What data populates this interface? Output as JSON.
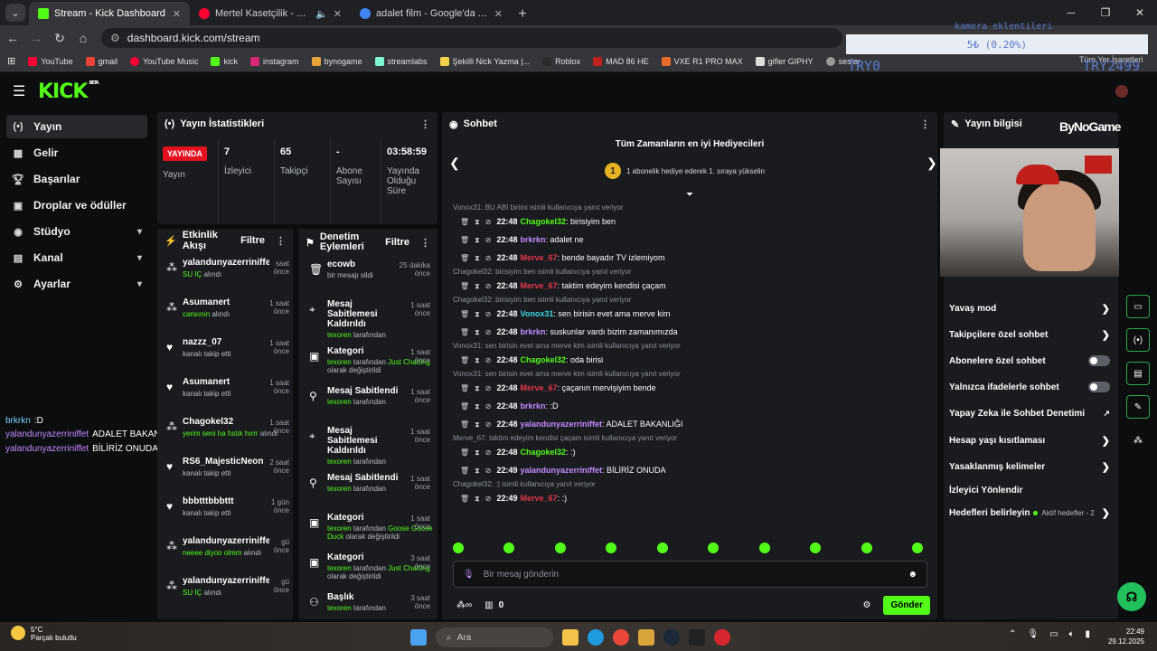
{
  "browser": {
    "tabs": [
      {
        "title": "Stream - Kick Dashboard",
        "color": "#53fc18"
      },
      {
        "title": "Mertel Kasetçilik - YouTube",
        "color": "#ff0033"
      },
      {
        "title": "adalet film - Google'da Ara",
        "color": "#4285f4"
      }
    ],
    "url": "dashboard.kick.com/stream",
    "bookmarks": [
      "YouTube",
      "gmail",
      "YouTube Music",
      "kick",
      "instagram",
      "bynogame",
      "streamlabs",
      "Şekilli Nick Yazma |...",
      "Roblox",
      "MAD 86 HE",
      "VXE R1 PRO MAX",
      "gifler GIPHY",
      "sesler"
    ],
    "bookmarks_right": "Tüm Yer İşaretleri"
  },
  "stream_overlay": {
    "cam_label": "kamera eklentileri",
    "goal_text": "5₺ (0.20%)",
    "try_left": "TRY0",
    "try_right": "TRY2499",
    "chat_lines": [
      {
        "user": "brkrkn",
        "text": ":D"
      },
      {
        "user": "yalandunyazerriniffet",
        "text": "ADALET BAKANLIĞI"
      },
      {
        "user": "yalandunyazerriniffet",
        "text": "BİLİRİZ ONUDA"
      }
    ]
  },
  "kick": {
    "logo": "KICK",
    "logo_sup": "BETA",
    "accent": "#53fc18"
  },
  "sidebar": {
    "items": [
      {
        "label": "Yayın",
        "icon": "broadcast-icon"
      },
      {
        "label": "Gelir",
        "icon": "wallet-icon"
      },
      {
        "label": "Başarılar",
        "icon": "trophy-icon"
      },
      {
        "label": "Droplar ve ödüller",
        "icon": "gift-icon"
      },
      {
        "label": "Stüdyo",
        "icon": "studio-icon"
      },
      {
        "label": "Kanal",
        "icon": "channel-icon"
      },
      {
        "label": "Ayarlar",
        "icon": "gear-icon"
      }
    ]
  },
  "stats": {
    "title": "Yayın İstatistikleri",
    "live_badge": "YAYINDA",
    "stream_label": "Yayın",
    "viewers": "7",
    "viewers_label": "İzleyici",
    "followers": "65",
    "followers_label": "Takipçi",
    "subs": "-",
    "subs_label": "Abone Sayısı",
    "duration": "03:58:59",
    "duration_label": "Yayında Olduğu Süre"
  },
  "feed": {
    "title": "Etkinlik Akışı",
    "filter": "Filtre",
    "items": [
      {
        "name": "yalandunyazerriniffet",
        "time": "saat önce",
        "pre": "SU İÇ",
        "post": " alındı",
        "icon": "drop"
      },
      {
        "name": "Asumanert",
        "time": "1 saat önce",
        "pre": "cansının",
        "post": " alındı",
        "icon": "drop"
      },
      {
        "name": "nazzz_07",
        "time": "1 saat önce",
        "pre": "",
        "post": "kanalı takip etti",
        "icon": "heart"
      },
      {
        "name": "Asumanert",
        "time": "1 saat önce",
        "pre": "",
        "post": "kanalı takip etti",
        "icon": "heart"
      },
      {
        "name": "Chagokel32",
        "time": "1 saat önce",
        "pre": "yerim seni ha fıstık hırrr",
        "post": " alındı",
        "icon": "drop"
      },
      {
        "name": "RS6_MajesticNeon",
        "time": "2 saat önce",
        "pre": "",
        "post": "kanalı takip etti",
        "icon": "heart"
      },
      {
        "name": "bbbtttbbbttt",
        "time": "1 gün önce",
        "pre": "",
        "post": "kanalı takip etti",
        "icon": "heart"
      },
      {
        "name": "yalandunyazerriniffet",
        "time": "gü önce",
        "pre": "neeee diyoo olmm",
        "post": " alındı",
        "icon": "drop"
      },
      {
        "name": "yalandunyazerriniffet",
        "time": "gü önce",
        "pre": "SU İÇ",
        "post": " alındı",
        "icon": "drop"
      }
    ]
  },
  "mod": {
    "title": "Denetim Eylemleri",
    "filter": "Filtre",
    "items": [
      {
        "title": "ecowb",
        "time": "25 dakika önce",
        "sub_user": "",
        "sub_text": "bir mesajı sildi",
        "icon": "trash"
      },
      {
        "title": "Mesaj Sabitlemesi Kaldırıldı",
        "time": "1 saat önce",
        "sub_user": "texoren",
        "sub_text": " tarafından",
        "icon": "pin-off"
      },
      {
        "title": "Kategori",
        "time": "1 saat önce",
        "sub_user": "texoren",
        "sub_text": " tarafından ",
        "extra": "Just Chatting",
        "tail": " olarak değiştirildi",
        "icon": "category"
      },
      {
        "title": "Mesaj Sabitlendi",
        "time": "1 saat önce",
        "sub_user": "texoren",
        "sub_text": " tarafından",
        "icon": "pin"
      },
      {
        "title": "Mesaj Sabitlemesi Kaldırıldı",
        "time": "1 saat önce",
        "sub_user": "texoren",
        "sub_text": " tarafından",
        "icon": "pin-off"
      },
      {
        "title": "Mesaj Sabitlendi",
        "time": "1 saat önce",
        "sub_user": "texoren",
        "sub_text": " tarafından",
        "icon": "pin"
      },
      {
        "title": "Kategori",
        "time": "1 saat önce",
        "sub_user": "texoren",
        "sub_text": " tarafından ",
        "extra": "Goose Goose Duck",
        "tail": " olarak değiştirildi",
        "icon": "category"
      },
      {
        "title": "Kategori",
        "time": "3 saat önce",
        "sub_user": "texoren",
        "sub_text": " tarafından ",
        "extra": "Just Chatting",
        "tail": " olarak değiştirildi",
        "icon": "category"
      },
      {
        "title": "Başlık",
        "time": "3 saat önce",
        "sub_user": "texoren",
        "sub_text": " tarafından",
        "icon": "title"
      }
    ]
  },
  "chat": {
    "title": "Sohbet",
    "gifters_title": "Tüm Zamanların en iyi Hediyecileri",
    "gifters_rank": "1",
    "gifters_sub": "1 abonelik hediye ederek 1. sıraya yükselin",
    "messages": [
      {
        "reply": "Vonox31: BU ABİ birimi isimli kullanıcıya yanıt veriyor",
        "time": "22:48",
        "user": "Chagokel32",
        "color": "#53fc18",
        "text": ": birisiyim ben"
      },
      {
        "reply": "",
        "time": "22:48",
        "user": "brkrkn",
        "color": "#c28cff",
        "text": ": adalet ne"
      },
      {
        "reply": "",
        "time": "22:48",
        "user": "Merve_67",
        "color": "#e3364b",
        "text": ": bende bayadır TV izlemiyom"
      },
      {
        "reply": "Chagokel32: birisiyim ben isimli kullanıcıya yanıt veriyor",
        "time": "22:48",
        "user": "Merve_67",
        "color": "#e3364b",
        "text": ": taktim edeyim kendisi çaçam"
      },
      {
        "reply": "Chagokel32: birisiyim ben isimli kullanıcıya yanıt veriyor",
        "time": "22:48",
        "user": "Vonox31",
        "color": "#3dd6e0",
        "text": ": sen birisin evet ama merve kim"
      },
      {
        "reply": "",
        "time": "22:48",
        "user": "brkrkn",
        "color": "#c28cff",
        "text": ": suskunlar vardı bizim zamanımızda"
      },
      {
        "reply": "Vonox31: sen birisin evet ama merve kim isimli kullanıcıya yanıt veriyor",
        "time": "22:48",
        "user": "Chagokel32",
        "color": "#53fc18",
        "text": ": oda birisi"
      },
      {
        "reply": "Vonox31: sen birisin evet ama merve kim isimli kullanıcıya yanıt veriyor",
        "time": "22:48",
        "user": "Merve_67",
        "color": "#e3364b",
        "text": ": çaçanın mervişiyim bende"
      },
      {
        "reply": "",
        "time": "22:48",
        "user": "brkrkn",
        "color": "#c28cff",
        "text": ": :D"
      },
      {
        "reply": "",
        "time": "22:48",
        "user": "yalandunyazerriniffet",
        "color": "#c28cff",
        "text": ": ADALET BAKANLIĞI"
      },
      {
        "reply": "Merve_67: taktim edeyim kendisi çaçam isimli kullanıcıya yanıt veriyor",
        "time": "22:48",
        "user": "Chagokel32",
        "color": "#53fc18",
        "text": ": :)"
      },
      {
        "reply": "",
        "time": "22:49",
        "user": "yalandunyazerriniffet",
        "color": "#c28cff",
        "text": ": BİLİRİZ ONUDA"
      },
      {
        "reply": "Chagokel32: :) isimli kullanıcıya yanıt veriyor",
        "time": "22:49",
        "user": "Merve_67",
        "color": "#e3364b",
        "text": ": :)"
      }
    ],
    "input_placeholder": "Bir mesaj gönderin",
    "points": "0",
    "send": "Gönder"
  },
  "info": {
    "title": "Yayın bilgisi",
    "brand": "ByNoGame",
    "rows": [
      {
        "label": "Yavaş mod",
        "type": "chevron"
      },
      {
        "label": "Takipçilere özel sohbet",
        "type": "chevron"
      },
      {
        "label": "Abonelere özel sohbet",
        "type": "toggle"
      },
      {
        "label": "Yalnızca ifadelerle sohbet",
        "type": "toggle"
      },
      {
        "label": "Yapay Zeka ile Sohbet Denetimi",
        "type": "external"
      },
      {
        "label": "Hesap yaşı kısıtlaması",
        "type": "chevron"
      },
      {
        "label": "Yasaklanmış kelimeler",
        "type": "chevron"
      },
      {
        "label": "İzleyici Yönlendir",
        "type": "none"
      },
      {
        "label": "Hedefleri belirleyin",
        "type": "goal",
        "sub": "Aktif hedefler - 2"
      }
    ]
  },
  "taskbar": {
    "temp": "5°C",
    "weather": "Parçalı bulutlu",
    "search": "Ara",
    "time": "22:49",
    "date": "29.12.2025"
  }
}
